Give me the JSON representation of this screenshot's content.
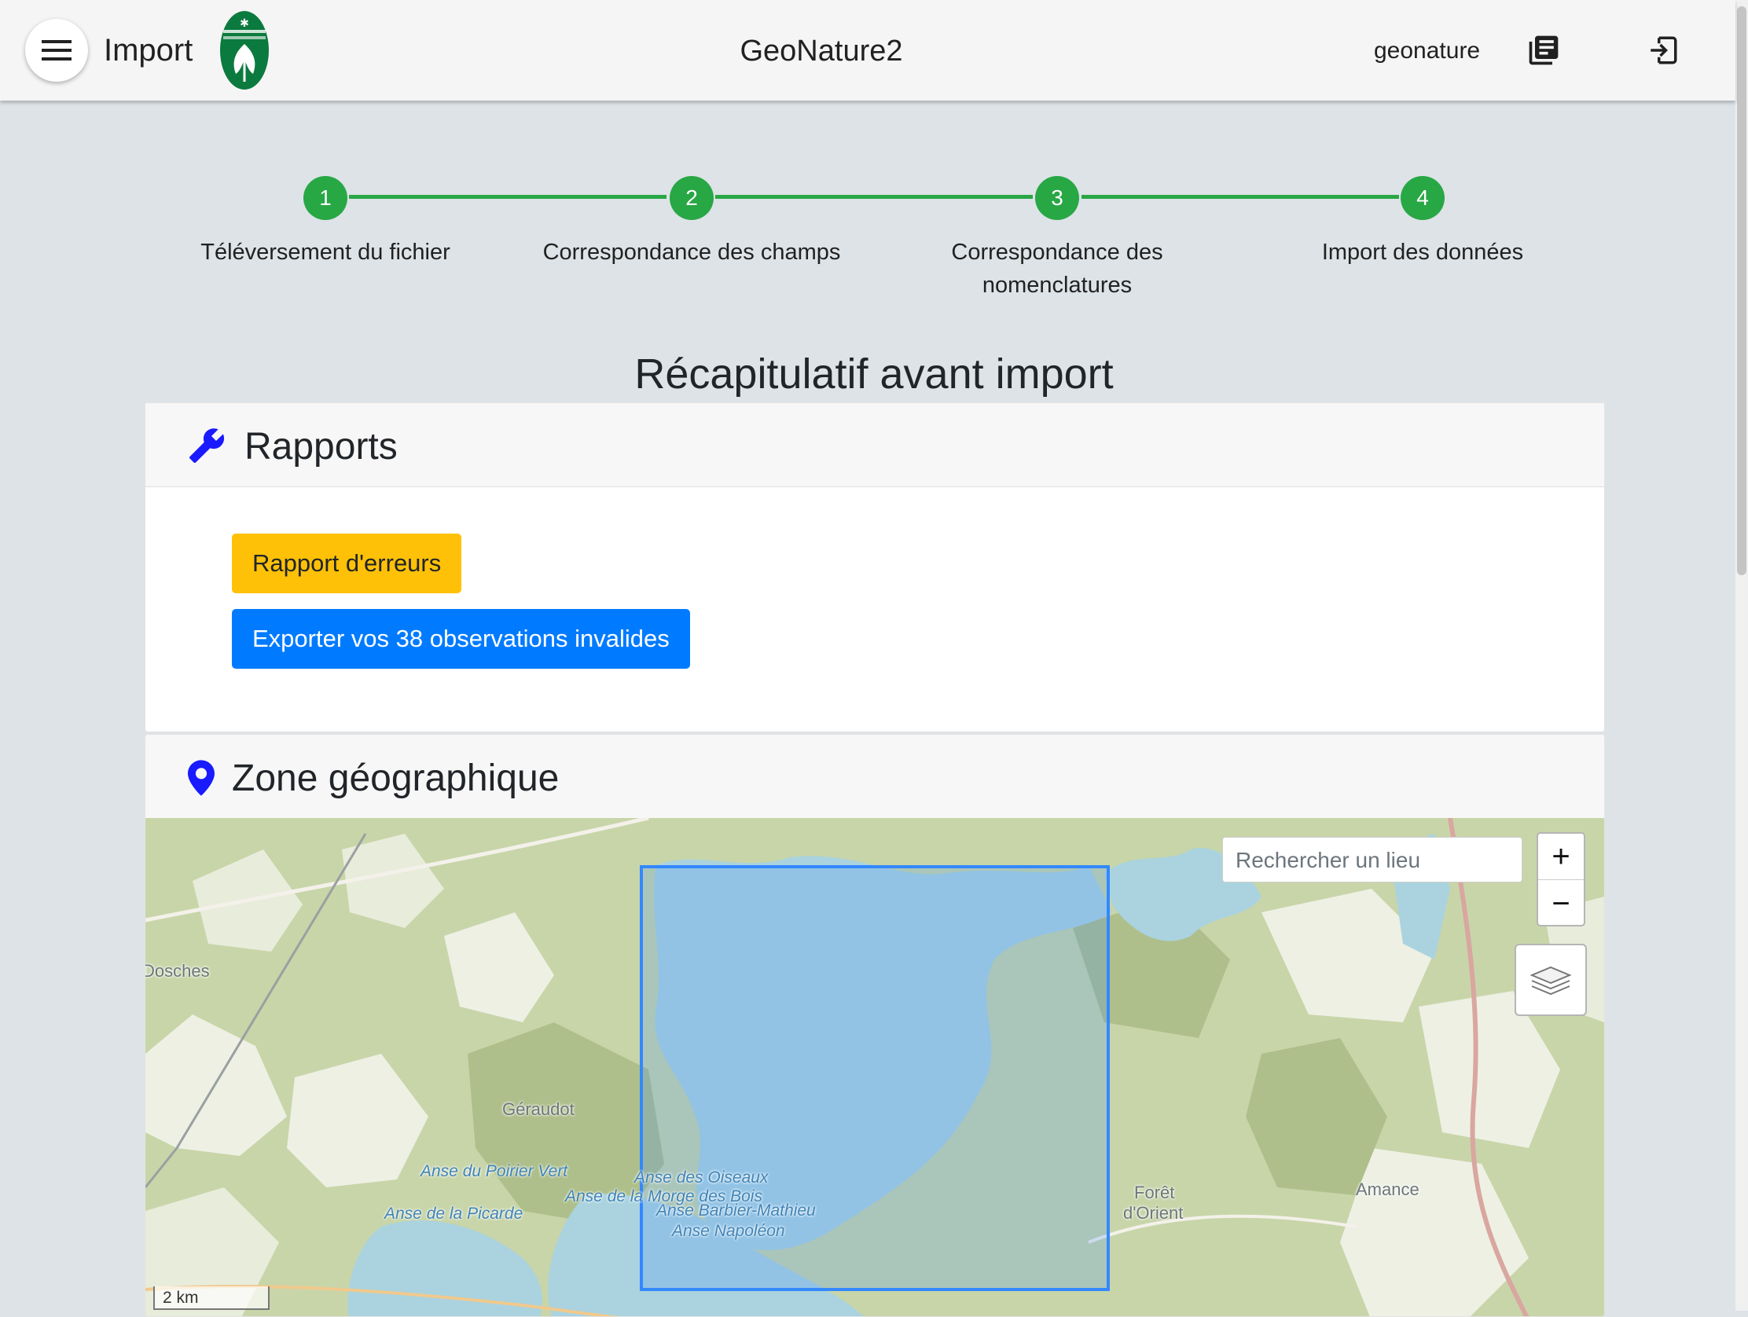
{
  "header": {
    "module_title": "Import",
    "app_title": "GeoNature2",
    "user": "geonature",
    "icons": {
      "menu": "menu-icon",
      "docs": "library-books-icon",
      "logout": "logout-icon",
      "logo": "park-logo"
    }
  },
  "stepper": {
    "accent": "#28a745",
    "steps": [
      {
        "number": "1",
        "label": "Téléversement du fichier"
      },
      {
        "number": "2",
        "label": "Correspondance des champs"
      },
      {
        "number": "3",
        "label": "Correspondance des nomenclatures"
      },
      {
        "number": "4",
        "label": "Import des données"
      }
    ]
  },
  "page_title": "Récapitulatif avant import",
  "rapports": {
    "title": "Rapports",
    "icon": "wrench-icon",
    "error_report_button": "Rapport d'erreurs",
    "export_invalid_button": "Exporter vos 38 observations invalides",
    "colors": {
      "warning": "#ffc107",
      "primary": "#007bff"
    }
  },
  "zone": {
    "title": "Zone géographique",
    "icon": "map-marker-icon",
    "map": {
      "search_placeholder": "Rechercher un lieu",
      "zoom_in": "+",
      "zoom_out": "−",
      "layers_icon": "layers-icon",
      "scale": "2 km",
      "labels": {
        "dosches": "Dosches",
        "geraudot": "Géraudot",
        "anse_poirier": "Anse du Poirier Vert",
        "anse_picarde": "Anse de la Picarde",
        "anse_oiseaux": "Anse des Oiseaux",
        "anse_morge": "Anse de la Morge des Bois",
        "anse_barbier": "Anse Barbier-Mathieu",
        "anse_napoleon": "Anse Napoléon",
        "foret_1": "Forêt",
        "foret_2": "d'Orient",
        "amance": "Amance"
      },
      "bbox_color": "#3388ff"
    }
  }
}
